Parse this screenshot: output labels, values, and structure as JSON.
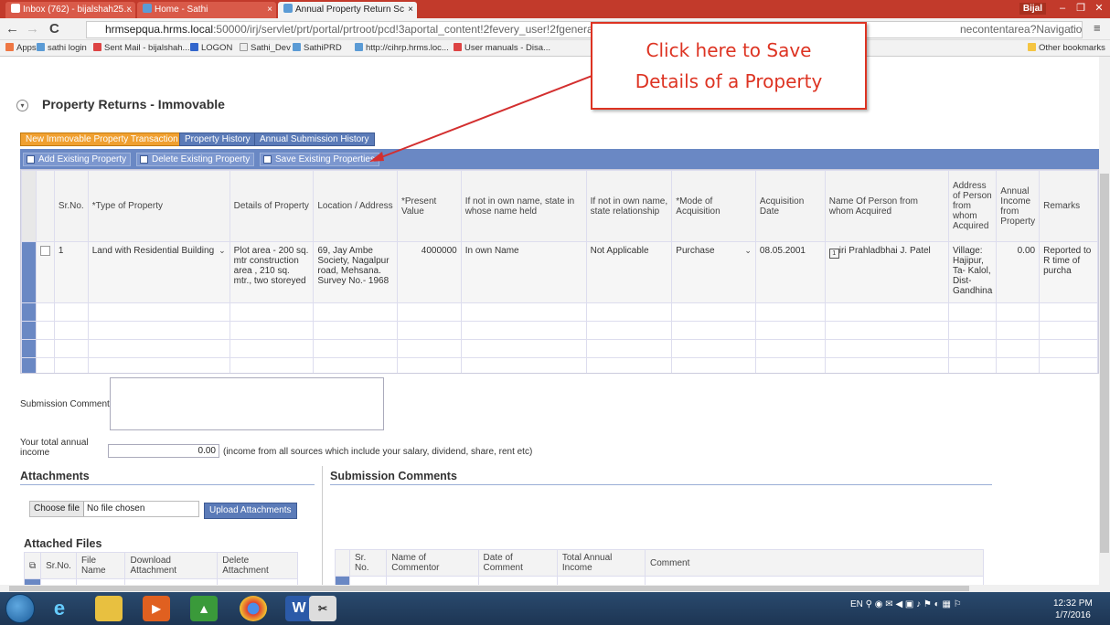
{
  "browser": {
    "tabs": [
      {
        "label": "Inbox (762) - bijalshah25…",
        "active": false
      },
      {
        "label": "Home - Sathi",
        "active": false
      },
      {
        "label": "Annual Property Return Sc",
        "active": true
      }
    ],
    "user_badge": "Bijal",
    "url_host": "hrmsepqua.hrms.local",
    "url_rest": ":50000/irj/servlet/prt/portal/prtroot/pcd!3aportal_content!2fevery_user!2fgeneral!",
    "url_tail": "necontentarea?NavigationTarget=navurl",
    "bookmarks": [
      "Apps",
      "sathi login",
      "Sent Mail - bijalshah...",
      "LOGON",
      "Sathi_Dev",
      "SathiPRD",
      "http://cihrp.hrms.loc...",
      "User manuals - Disa..."
    ],
    "other_bookmarks": "Other bookmarks"
  },
  "page": {
    "title": "Property Returns - Immovable",
    "top_buttons": [
      "New Immovable Property Transaction",
      "Property History",
      "Annual Submission History"
    ],
    "toolbar": {
      "add": "Add Existing Property",
      "delete": "Delete Existing Property",
      "save": "Save Existing Properties"
    },
    "grid": {
      "headers": [
        "Sr.No.",
        "*Type of Property",
        "Details of Property",
        "Location / Address",
        "*Present Value",
        "If not in own name, state in whose name held",
        "If not in own name, state relationship",
        "*Mode of Acquisition",
        "Acquisition Date",
        "Name Of Person from whom Acquired",
        "Address of Person from whom Acquired",
        "Annual Income from Property",
        "Remarks"
      ],
      "row": {
        "srno": "1",
        "type": "Land with Residential Building",
        "details": "Plot area - 200 sq. mtr construction area , 210 sq. mtr., two storeyed",
        "location": "69, Jay Ambe Society, Nagalpur road, Mehsana. Survey No.- 1968",
        "value": "4000000",
        "held": "In own Name",
        "relationship": "Not Applicable",
        "mode": "Purchase",
        "date": "08.05.2001",
        "person": "iri Prahladbhai J. Patel",
        "person_address": "Village: Hajipur, Ta- Kalol, Dist- Gandhina",
        "income": "0.00",
        "remarks": "Reported to R time of purcha"
      }
    },
    "submission_comments_label": "Submission Comments",
    "income_label": "Your total annual income",
    "income_value": "0.00",
    "income_note": "(income from all sources which include your salary, dividend, share, rent etc)",
    "attachments_title": "Attachments",
    "choose_file": "Choose file",
    "no_file": "No file chosen",
    "upload": "Upload Attachments",
    "attached_files_title": "Attached Files",
    "attached_headers": [
      "Sr.No.",
      "File Name",
      "Download Attachment",
      "Delete Attachment"
    ],
    "submission_title": "Submission Comments",
    "comment_headers": [
      "Sr. No.",
      "Name of Commentor",
      "Date of Comment",
      "Total Annual Income",
      "Comment"
    ]
  },
  "callout": {
    "line1": "Click here to Save",
    "line2": "Details of a Property"
  },
  "taskbar": {
    "lang": "EN",
    "time": "12:32 PM",
    "date": "1/7/2016"
  },
  "colors": {
    "accent": "#6a88c4",
    "callout": "#d32f2f",
    "orange_button": "#f0a030"
  }
}
